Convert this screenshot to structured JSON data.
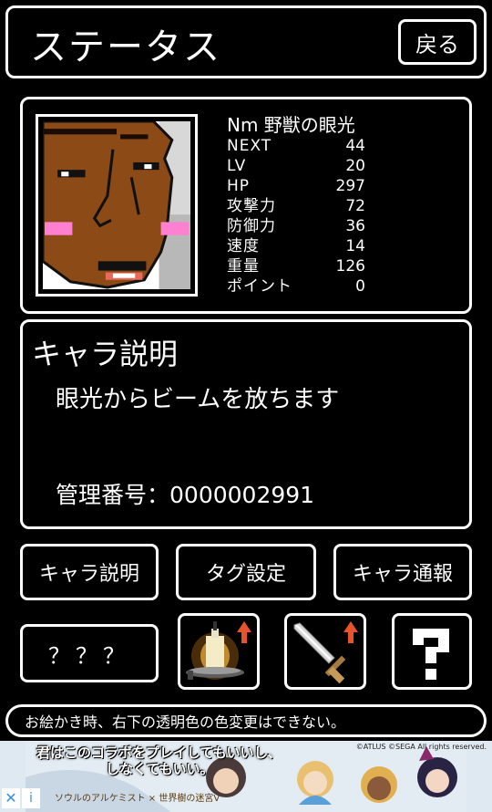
{
  "header": {
    "title": "ステータス",
    "back_label": "戻る"
  },
  "character": {
    "name": "Nm 野獣の眼光",
    "stats": [
      {
        "label": "NEXT",
        "value": "44"
      },
      {
        "label": "LV",
        "value": "20"
      },
      {
        "label": "HP",
        "value": "297"
      },
      {
        "label": "攻撃力",
        "value": "72"
      },
      {
        "label": "防御力",
        "value": "36"
      },
      {
        "label": "速度",
        "value": "14"
      },
      {
        "label": "重量",
        "value": "126"
      },
      {
        "label": "ポイント",
        "value": "0"
      }
    ]
  },
  "description": {
    "heading": "キャラ説明",
    "text": "眼光からビームを放ちます",
    "management_label": "管理番号：",
    "management_number": "0000002991"
  },
  "buttons": {
    "describe": "キャラ説明",
    "tag": "タグ設定",
    "report": "キャラ通報",
    "unknown": "？？？"
  },
  "icons": {
    "candle": "candle-upgrade-icon",
    "sword": "sword-upgrade-icon",
    "help": "question-mark-icon"
  },
  "notice": "お絵かき時、右下の透明色の色変更はできない。",
  "ad": {
    "line1": "君はこのコラボをプレイしてもいいし、",
    "line2": "しなくてもいい。",
    "copyright": "©ATLUS ©SEGA All rights reserved.",
    "logo": "ソウルのアルケミスト × 世界樹の迷宮V",
    "close": "✕",
    "info": "i"
  },
  "colors": {
    "background": "#000000",
    "foreground": "#ffffff",
    "upgrade_arrow": "#e8542a",
    "blush": "#ff7fd0"
  }
}
